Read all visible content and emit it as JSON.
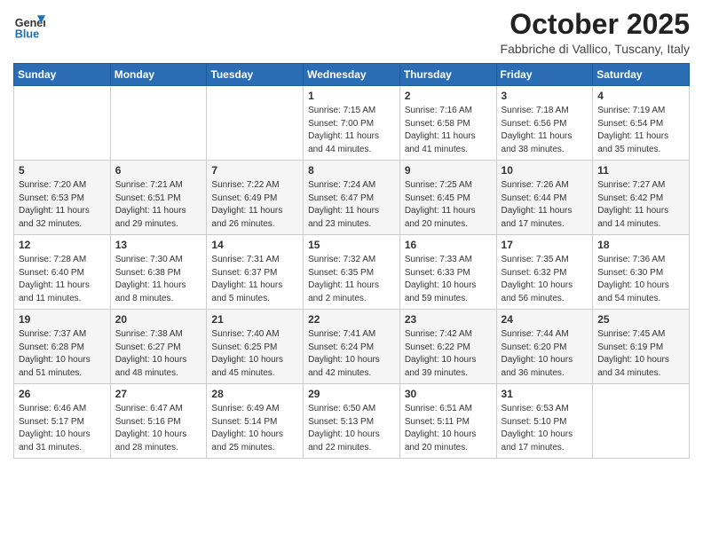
{
  "logo": {
    "general": "General",
    "blue": "Blue"
  },
  "header": {
    "month": "October 2025",
    "location": "Fabbriche di Vallico, Tuscany, Italy"
  },
  "days_of_week": [
    "Sunday",
    "Monday",
    "Tuesday",
    "Wednesday",
    "Thursday",
    "Friday",
    "Saturday"
  ],
  "weeks": [
    [
      {
        "num": "",
        "info": ""
      },
      {
        "num": "",
        "info": ""
      },
      {
        "num": "",
        "info": ""
      },
      {
        "num": "1",
        "info": "Sunrise: 7:15 AM\nSunset: 7:00 PM\nDaylight: 11 hours\nand 44 minutes."
      },
      {
        "num": "2",
        "info": "Sunrise: 7:16 AM\nSunset: 6:58 PM\nDaylight: 11 hours\nand 41 minutes."
      },
      {
        "num": "3",
        "info": "Sunrise: 7:18 AM\nSunset: 6:56 PM\nDaylight: 11 hours\nand 38 minutes."
      },
      {
        "num": "4",
        "info": "Sunrise: 7:19 AM\nSunset: 6:54 PM\nDaylight: 11 hours\nand 35 minutes."
      }
    ],
    [
      {
        "num": "5",
        "info": "Sunrise: 7:20 AM\nSunset: 6:53 PM\nDaylight: 11 hours\nand 32 minutes."
      },
      {
        "num": "6",
        "info": "Sunrise: 7:21 AM\nSunset: 6:51 PM\nDaylight: 11 hours\nand 29 minutes."
      },
      {
        "num": "7",
        "info": "Sunrise: 7:22 AM\nSunset: 6:49 PM\nDaylight: 11 hours\nand 26 minutes."
      },
      {
        "num": "8",
        "info": "Sunrise: 7:24 AM\nSunset: 6:47 PM\nDaylight: 11 hours\nand 23 minutes."
      },
      {
        "num": "9",
        "info": "Sunrise: 7:25 AM\nSunset: 6:45 PM\nDaylight: 11 hours\nand 20 minutes."
      },
      {
        "num": "10",
        "info": "Sunrise: 7:26 AM\nSunset: 6:44 PM\nDaylight: 11 hours\nand 17 minutes."
      },
      {
        "num": "11",
        "info": "Sunrise: 7:27 AM\nSunset: 6:42 PM\nDaylight: 11 hours\nand 14 minutes."
      }
    ],
    [
      {
        "num": "12",
        "info": "Sunrise: 7:28 AM\nSunset: 6:40 PM\nDaylight: 11 hours\nand 11 minutes."
      },
      {
        "num": "13",
        "info": "Sunrise: 7:30 AM\nSunset: 6:38 PM\nDaylight: 11 hours\nand 8 minutes."
      },
      {
        "num": "14",
        "info": "Sunrise: 7:31 AM\nSunset: 6:37 PM\nDaylight: 11 hours\nand 5 minutes."
      },
      {
        "num": "15",
        "info": "Sunrise: 7:32 AM\nSunset: 6:35 PM\nDaylight: 11 hours\nand 2 minutes."
      },
      {
        "num": "16",
        "info": "Sunrise: 7:33 AM\nSunset: 6:33 PM\nDaylight: 10 hours\nand 59 minutes."
      },
      {
        "num": "17",
        "info": "Sunrise: 7:35 AM\nSunset: 6:32 PM\nDaylight: 10 hours\nand 56 minutes."
      },
      {
        "num": "18",
        "info": "Sunrise: 7:36 AM\nSunset: 6:30 PM\nDaylight: 10 hours\nand 54 minutes."
      }
    ],
    [
      {
        "num": "19",
        "info": "Sunrise: 7:37 AM\nSunset: 6:28 PM\nDaylight: 10 hours\nand 51 minutes."
      },
      {
        "num": "20",
        "info": "Sunrise: 7:38 AM\nSunset: 6:27 PM\nDaylight: 10 hours\nand 48 minutes."
      },
      {
        "num": "21",
        "info": "Sunrise: 7:40 AM\nSunset: 6:25 PM\nDaylight: 10 hours\nand 45 minutes."
      },
      {
        "num": "22",
        "info": "Sunrise: 7:41 AM\nSunset: 6:24 PM\nDaylight: 10 hours\nand 42 minutes."
      },
      {
        "num": "23",
        "info": "Sunrise: 7:42 AM\nSunset: 6:22 PM\nDaylight: 10 hours\nand 39 minutes."
      },
      {
        "num": "24",
        "info": "Sunrise: 7:44 AM\nSunset: 6:20 PM\nDaylight: 10 hours\nand 36 minutes."
      },
      {
        "num": "25",
        "info": "Sunrise: 7:45 AM\nSunset: 6:19 PM\nDaylight: 10 hours\nand 34 minutes."
      }
    ],
    [
      {
        "num": "26",
        "info": "Sunrise: 6:46 AM\nSunset: 5:17 PM\nDaylight: 10 hours\nand 31 minutes."
      },
      {
        "num": "27",
        "info": "Sunrise: 6:47 AM\nSunset: 5:16 PM\nDaylight: 10 hours\nand 28 minutes."
      },
      {
        "num": "28",
        "info": "Sunrise: 6:49 AM\nSunset: 5:14 PM\nDaylight: 10 hours\nand 25 minutes."
      },
      {
        "num": "29",
        "info": "Sunrise: 6:50 AM\nSunset: 5:13 PM\nDaylight: 10 hours\nand 22 minutes."
      },
      {
        "num": "30",
        "info": "Sunrise: 6:51 AM\nSunset: 5:11 PM\nDaylight: 10 hours\nand 20 minutes."
      },
      {
        "num": "31",
        "info": "Sunrise: 6:53 AM\nSunset: 5:10 PM\nDaylight: 10 hours\nand 17 minutes."
      },
      {
        "num": "",
        "info": ""
      }
    ]
  ]
}
